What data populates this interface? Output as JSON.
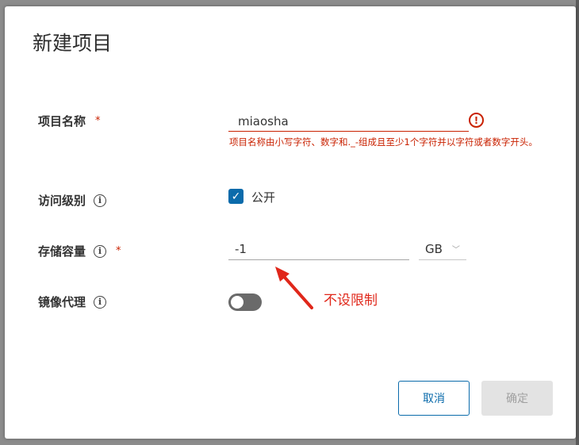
{
  "dialog": {
    "title": "新建项目",
    "project_name": {
      "label": "项目名称",
      "required_mark": "*",
      "value": "miaosha",
      "error_message": "项目名称由小写字符、数字和._-组成且至少1个字符并以字符或者数字开头。",
      "error_icon": "!"
    },
    "access_level": {
      "label": "访问级别",
      "info_icon": "i",
      "checkbox_checked": true,
      "checkbox_label": "公开"
    },
    "storage_quota": {
      "label": "存储容量",
      "info_icon": "i",
      "required_mark": "*",
      "value": "-1",
      "unit": "GB"
    },
    "proxy_cache": {
      "label": "镜像代理",
      "info_icon": "i",
      "enabled": false
    },
    "annotation": "不设限制",
    "buttons": {
      "cancel": "取消",
      "confirm": "确定"
    }
  },
  "colors": {
    "accent": "#0b6bab",
    "error": "#c92100",
    "annotation": "#e0271a"
  }
}
